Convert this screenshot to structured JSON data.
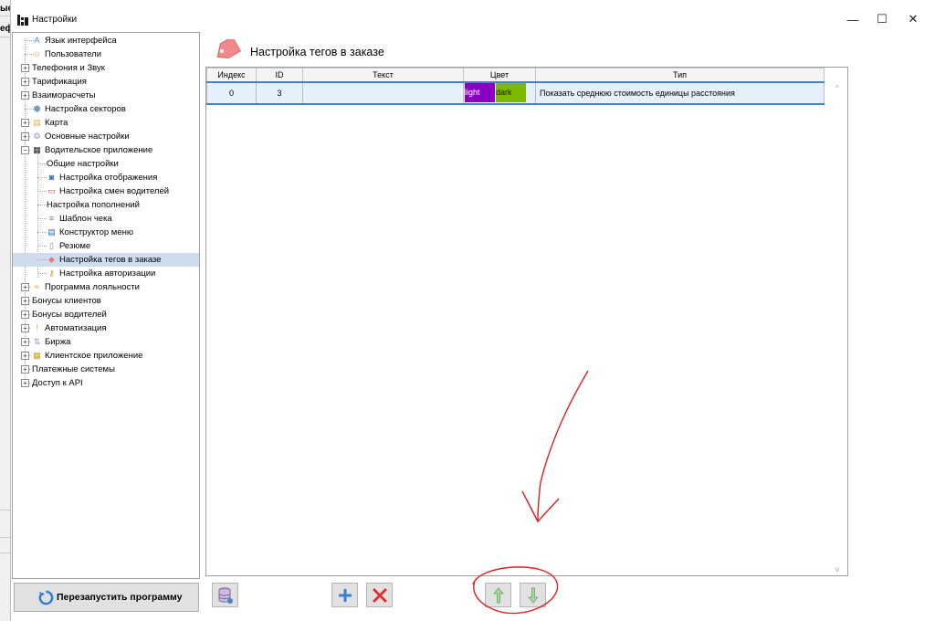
{
  "window": {
    "title": "Настройки",
    "minimize_glyph": "—",
    "maximize_glyph": "☐",
    "close_glyph": "✕"
  },
  "background_fragments": [
    "ые",
    "еф"
  ],
  "sidebar": {
    "items": [
      {
        "label": "Язык интерфейса",
        "icon": "language-icon",
        "level": 1
      },
      {
        "label": "Пользователи",
        "icon": "users-icon",
        "level": 1
      },
      {
        "label": "Телефония и Звук",
        "icon": "",
        "level": 0,
        "expander": "+"
      },
      {
        "label": "Тарификация",
        "icon": "",
        "level": 0,
        "expander": "+"
      },
      {
        "label": "Взаиморасчеты",
        "icon": "",
        "level": 0,
        "expander": "+"
      },
      {
        "label": "Настройка секторов",
        "icon": "sectors-icon",
        "level": 1
      },
      {
        "label": "Карта",
        "icon": "map-icon",
        "level": 0,
        "expander": "+"
      },
      {
        "label": "Основные настройки",
        "icon": "gear-icon",
        "level": 0,
        "expander": "+"
      },
      {
        "label": "Водительское приложение",
        "icon": "app-icon",
        "level": 0,
        "expander": "−"
      },
      {
        "label": "Общие настройки",
        "icon": "",
        "level": 2
      },
      {
        "label": "Настройка отображения",
        "icon": "display-icon",
        "level": 2
      },
      {
        "label": "Настройка смен водителей",
        "icon": "calendar-icon",
        "level": 2
      },
      {
        "label": "Настройка пополнений",
        "icon": "",
        "level": 2
      },
      {
        "label": "Шаблон чека",
        "icon": "receipt-icon",
        "level": 2
      },
      {
        "label": "Конструктор меню",
        "icon": "menu-builder-icon",
        "level": 2
      },
      {
        "label": "Резюме",
        "icon": "resume-icon",
        "level": 2
      },
      {
        "label": "Настройка тегов в заказе",
        "icon": "tag-icon",
        "level": 2,
        "selected": true
      },
      {
        "label": "Настройка авторизации",
        "icon": "key-icon",
        "level": 2
      },
      {
        "label": "Программа лояльности",
        "icon": "handshake-icon",
        "level": 0,
        "expander": "+"
      },
      {
        "label": "Бонусы клиентов",
        "icon": "",
        "level": 0,
        "expander": "+"
      },
      {
        "label": "Бонусы водителей",
        "icon": "",
        "level": 0,
        "expander": "+"
      },
      {
        "label": "Автоматизация",
        "icon": "alert-icon",
        "level": 0,
        "expander": "+"
      },
      {
        "label": "Биржа",
        "icon": "exchange-icon",
        "level": 0,
        "expander": "+"
      },
      {
        "label": "Клиентское приложение",
        "icon": "client-app-icon",
        "level": 0,
        "expander": "+"
      },
      {
        "label": "Платежные системы",
        "icon": "",
        "level": 0,
        "expander": "+"
      },
      {
        "label": "Доступ к API",
        "icon": "",
        "level": 0,
        "expander": "+"
      }
    ]
  },
  "restart_button": {
    "label": "Перезапустить программу"
  },
  "content": {
    "title": "Настройка тегов в заказе",
    "columns": [
      "Индекс",
      "ID",
      "Текст",
      "Цвет",
      "Тип"
    ],
    "rows": [
      {
        "index": "0",
        "id": "3",
        "text": "",
        "color_light": "light",
        "color_dark": "dark",
        "type": "Показать среднюю стоимость единицы расстояния"
      }
    ]
  },
  "colors": {
    "light_swatch": "#8a00c2",
    "dark_swatch": "#7fb800",
    "selection": "#cfdced",
    "annotation": "#e02020"
  }
}
